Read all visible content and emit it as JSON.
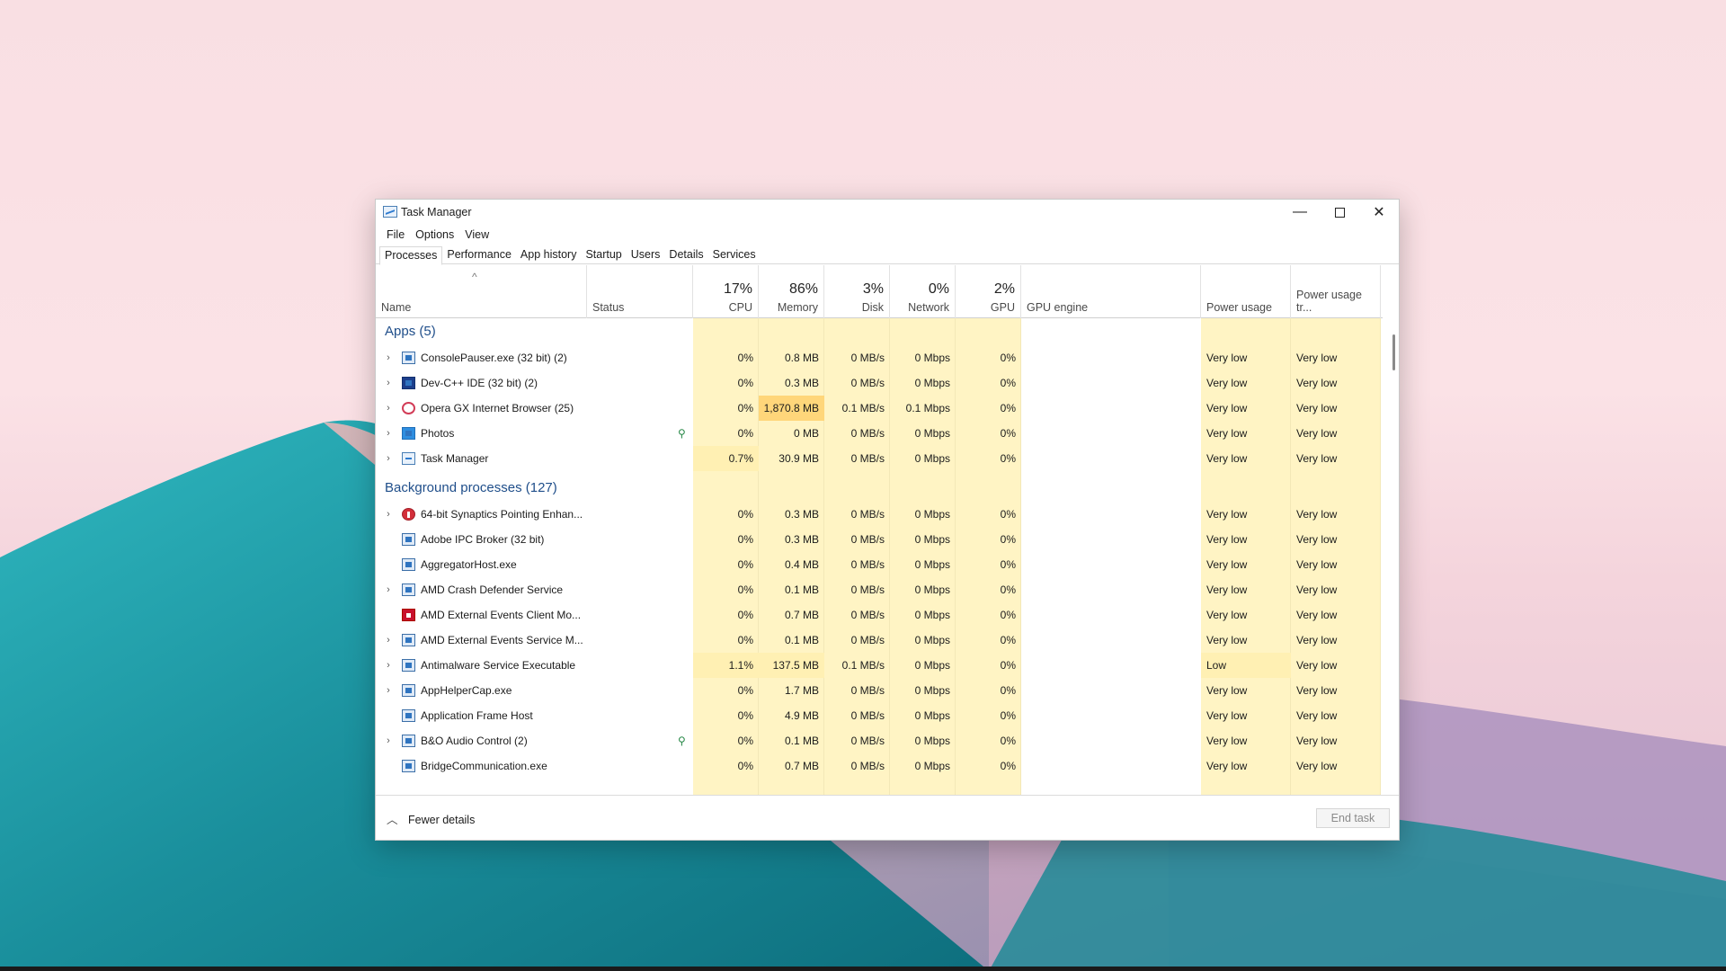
{
  "window": {
    "title": "Task Manager",
    "controls": {
      "minimize": "—",
      "close": "✕"
    }
  },
  "menu": [
    "File",
    "Options",
    "View"
  ],
  "tabs": [
    "Processes",
    "Performance",
    "App history",
    "Startup",
    "Users",
    "Details",
    "Services"
  ],
  "active_tab": "Processes",
  "header": {
    "name": "Name",
    "status": "Status",
    "cpu": {
      "pct": "17%",
      "label": "CPU"
    },
    "memory": {
      "pct": "86%",
      "label": "Memory"
    },
    "disk": {
      "pct": "3%",
      "label": "Disk"
    },
    "network": {
      "pct": "0%",
      "label": "Network"
    },
    "gpu": {
      "pct": "2%",
      "label": "GPU"
    },
    "gpu_engine": "GPU engine",
    "power": "Power usage",
    "power_trend": "Power usage tr...",
    "sort_arrow": "^"
  },
  "groups": {
    "apps": "Apps (5)",
    "background": "Background processes (127)"
  },
  "apps": [
    {
      "name": "ConsolePauser.exe (32 bit) (2)",
      "icon": "console-icon",
      "expand": true,
      "cpu": "0%",
      "memory": "0.8 MB",
      "disk": "0 MB/s",
      "network": "0 Mbps",
      "gpu": "0%",
      "power": "Very low",
      "trend": "Very low"
    },
    {
      "name": "Dev-C++ IDE (32 bit) (2)",
      "icon": "devcpp-icon",
      "expand": true,
      "cpu": "0%",
      "memory": "0.3 MB",
      "disk": "0 MB/s",
      "network": "0 Mbps",
      "gpu": "0%",
      "power": "Very low",
      "trend": "Very low"
    },
    {
      "name": "Opera GX Internet Browser (25)",
      "icon": "opera-icon",
      "expand": true,
      "cpu": "0%",
      "memory": "1,870.8 MB",
      "disk": "0.1 MB/s",
      "network": "0.1 Mbps",
      "gpu": "0%",
      "power": "Very low",
      "trend": "Very low",
      "hot_memory": true
    },
    {
      "name": "Photos",
      "icon": "photos-icon",
      "expand": true,
      "leaf": true,
      "cpu": "0%",
      "memory": "0 MB",
      "disk": "0 MB/s",
      "network": "0 Mbps",
      "gpu": "0%",
      "power": "Very low",
      "trend": "Very low"
    },
    {
      "name": "Task Manager",
      "icon": "task-manager-icon",
      "expand": true,
      "cpu": "0.7%",
      "memory": "30.9 MB",
      "disk": "0 MB/s",
      "network": "0 Mbps",
      "gpu": "0%",
      "power": "Very low",
      "trend": "Very low"
    }
  ],
  "background": [
    {
      "name": "64-bit Synaptics Pointing Enhan...",
      "icon": "synaptics-icon",
      "expand": true,
      "cpu": "0%",
      "memory": "0.3 MB",
      "disk": "0 MB/s",
      "network": "0 Mbps",
      "gpu": "0%",
      "power": "Very low",
      "trend": "Very low"
    },
    {
      "name": "Adobe IPC Broker (32 bit)",
      "icon": "adobe-icon",
      "expand": false,
      "cpu": "0%",
      "memory": "0.3 MB",
      "disk": "0 MB/s",
      "network": "0 Mbps",
      "gpu": "0%",
      "power": "Very low",
      "trend": "Very low"
    },
    {
      "name": "AggregatorHost.exe",
      "icon": "service-icon",
      "expand": false,
      "cpu": "0%",
      "memory": "0.4 MB",
      "disk": "0 MB/s",
      "network": "0 Mbps",
      "gpu": "0%",
      "power": "Very low",
      "trend": "Very low"
    },
    {
      "name": "AMD Crash Defender Service",
      "icon": "service-icon",
      "expand": true,
      "cpu": "0%",
      "memory": "0.1 MB",
      "disk": "0 MB/s",
      "network": "0 Mbps",
      "gpu": "0%",
      "power": "Very low",
      "trend": "Very low"
    },
    {
      "name": "AMD External Events Client Mo...",
      "icon": "amd-icon",
      "expand": false,
      "cpu": "0%",
      "memory": "0.7 MB",
      "disk": "0 MB/s",
      "network": "0 Mbps",
      "gpu": "0%",
      "power": "Very low",
      "trend": "Very low"
    },
    {
      "name": "AMD External Events Service M...",
      "icon": "service-icon",
      "expand": true,
      "cpu": "0%",
      "memory": "0.1 MB",
      "disk": "0 MB/s",
      "network": "0 Mbps",
      "gpu": "0%",
      "power": "Very low",
      "trend": "Very low"
    },
    {
      "name": "Antimalware Service Executable",
      "icon": "service-icon",
      "expand": true,
      "cpu": "1.1%",
      "memory": "137.5 MB",
      "disk": "0.1 MB/s",
      "network": "0 Mbps",
      "gpu": "0%",
      "power": "Low",
      "trend": "Very low"
    },
    {
      "name": "AppHelperCap.exe",
      "icon": "service-icon",
      "expand": true,
      "cpu": "0%",
      "memory": "1.7 MB",
      "disk": "0 MB/s",
      "network": "0 Mbps",
      "gpu": "0%",
      "power": "Very low",
      "trend": "Very low"
    },
    {
      "name": "Application Frame Host",
      "icon": "service-icon",
      "expand": false,
      "cpu": "0%",
      "memory": "4.9 MB",
      "disk": "0 MB/s",
      "network": "0 Mbps",
      "gpu": "0%",
      "power": "Very low",
      "trend": "Very low"
    },
    {
      "name": "B&O Audio Control (2)",
      "icon": "service-icon",
      "expand": true,
      "leaf": true,
      "cpu": "0%",
      "memory": "0.1 MB",
      "disk": "0 MB/s",
      "network": "0 Mbps",
      "gpu": "0%",
      "power": "Very low",
      "trend": "Very low"
    },
    {
      "name": "BridgeCommunication.exe",
      "icon": "service-icon",
      "expand": false,
      "cpu": "0%",
      "memory": "0.7 MB",
      "disk": "0 MB/s",
      "network": "0 Mbps",
      "gpu": "0%",
      "power": "Very low",
      "trend": "Very low"
    }
  ],
  "footer": {
    "fewer_details": "Fewer details",
    "end_task": "End task"
  },
  "colors": {
    "heat_light": "#fff4c4",
    "heat_hot": "#ffd67a",
    "group_title": "#1f4e8a"
  }
}
